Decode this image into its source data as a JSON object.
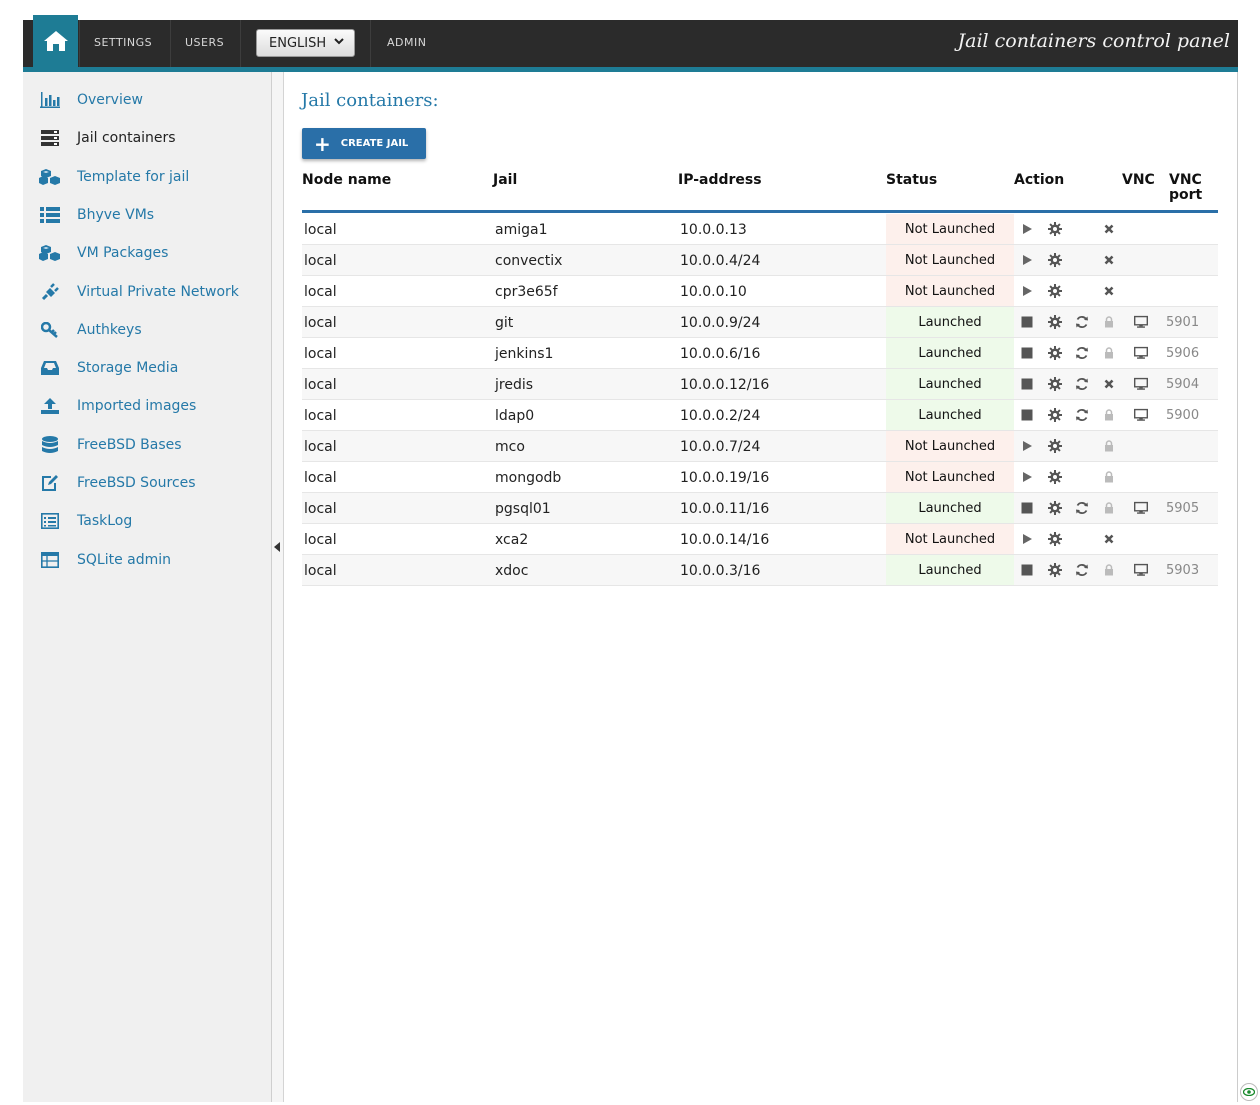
{
  "header": {
    "nav": [
      "SETTINGS",
      "USERS",
      "ADMIN"
    ],
    "language": "ENGLISH",
    "brand": "Jail containers control panel"
  },
  "sidebar": {
    "items": [
      {
        "label": "Overview",
        "icon": "chart-icon"
      },
      {
        "label": "Jail containers",
        "icon": "server-icon"
      },
      {
        "label": "Template for jail",
        "icon": "cubes-icon"
      },
      {
        "label": "Bhyve VMs",
        "icon": "list-icon"
      },
      {
        "label": "VM Packages",
        "icon": "cubes-icon"
      },
      {
        "label": "Virtual Private Network",
        "icon": "plug-icon"
      },
      {
        "label": "Authkeys",
        "icon": "key-icon"
      },
      {
        "label": "Storage Media",
        "icon": "inbox-icon"
      },
      {
        "label": "Imported images",
        "icon": "upload-icon"
      },
      {
        "label": "FreeBSD Bases",
        "icon": "database-icon"
      },
      {
        "label": "FreeBSD Sources",
        "icon": "edit-icon"
      },
      {
        "label": "TaskLog",
        "icon": "list-alt-icon"
      },
      {
        "label": "SQLite admin",
        "icon": "table-icon"
      }
    ],
    "active_index": 1
  },
  "main": {
    "title": "Jail containers:",
    "create_button": "CREATE JAIL",
    "columns": [
      "Node name",
      "Jail",
      "IP-address",
      "Status",
      "Action",
      "VNC",
      "VNC port"
    ],
    "rows": [
      {
        "node": "local",
        "jail": "amiga1",
        "ip": "10.0.0.13",
        "status": "Not Launched",
        "port": ""
      },
      {
        "node": "local",
        "jail": "convectix",
        "ip": "10.0.0.4/24",
        "status": "Not Launched",
        "port": ""
      },
      {
        "node": "local",
        "jail": "cpr3e65f",
        "ip": "10.0.0.10",
        "status": "Not Launched",
        "port": ""
      },
      {
        "node": "local",
        "jail": "git",
        "ip": "10.0.0.9/24",
        "status": "Launched",
        "port": "5901"
      },
      {
        "node": "local",
        "jail": "jenkins1",
        "ip": "10.0.0.6/16",
        "status": "Launched",
        "port": "5906"
      },
      {
        "node": "local",
        "jail": "jredis",
        "ip": "10.0.0.12/16",
        "status": "Launched",
        "port": "5904"
      },
      {
        "node": "local",
        "jail": "ldap0",
        "ip": "10.0.0.2/24",
        "status": "Launched",
        "port": "5900"
      },
      {
        "node": "local",
        "jail": "mco",
        "ip": "10.0.0.7/24",
        "status": "Not Launched",
        "port": ""
      },
      {
        "node": "local",
        "jail": "mongodb",
        "ip": "10.0.0.19/16",
        "status": "Not Launched",
        "port": ""
      },
      {
        "node": "local",
        "jail": "pgsql01",
        "ip": "10.0.0.11/16",
        "status": "Launched",
        "port": "5905"
      },
      {
        "node": "local",
        "jail": "xca2",
        "ip": "10.0.0.14/16",
        "status": "Not Launched",
        "port": ""
      },
      {
        "node": "local",
        "jail": "xdoc",
        "ip": "10.0.0.3/16",
        "status": "Launched",
        "port": "5903"
      }
    ]
  },
  "colors": {
    "accent": "#1e7c95",
    "link": "#2579a8",
    "button": "#2a6fa8",
    "not_launched_bg": "#fdf0ec",
    "launched_bg": "#eefaea"
  }
}
